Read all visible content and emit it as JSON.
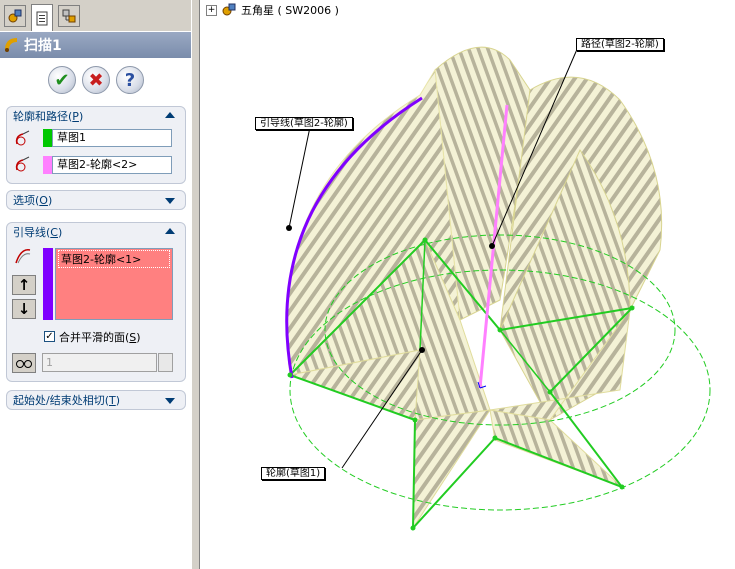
{
  "panel": {
    "tabs": [
      "feature-manager-tab",
      "property-manager-tab",
      "configuration-manager-tab"
    ],
    "title": "扫描1",
    "buttons": {
      "ok": "✔",
      "cancel": "✖",
      "help": "?"
    },
    "profile_path": {
      "heading": "轮廓和路径(P)",
      "heading_main": "轮廓和路径(",
      "heading_key": "P",
      "heading_end": ")",
      "profile_value": "草图1",
      "path_value": "草图2-轮廓<2>",
      "profile_color": "#00c800",
      "path_color": "#ff80ff"
    },
    "options": {
      "heading_main": "选项(",
      "heading_key": "O",
      "heading_end": ")"
    },
    "guides": {
      "heading_main": "引导线(",
      "heading_key": "C",
      "heading_end": ")",
      "items": [
        "草图2-轮廓<1>"
      ],
      "list_color": "#ff8080",
      "swatch_color": "#8000ff",
      "merge_label_main": "合并平滑的面(",
      "merge_label_key": "S",
      "merge_label_end": ")",
      "merge_checked": true,
      "spin_value": "1"
    },
    "tangency": {
      "heading_main": "起始处/结束处相切(",
      "heading_key": "T",
      "heading_end": ")"
    }
  },
  "tree": {
    "root_label": "五角星 ( SW2006 )",
    "expander": "+"
  },
  "callouts": {
    "path": "路径(草图2-轮廓)",
    "guide": "引导线(草图2-轮廓)",
    "profile": "轮廓(草图1)"
  },
  "colors": {
    "guide_curve": "#8000ff",
    "path_line": "#ff80ff",
    "profile_lines": "#22cc22",
    "surface": "#f4f2d6",
    "stripe": "#b7b39b"
  }
}
